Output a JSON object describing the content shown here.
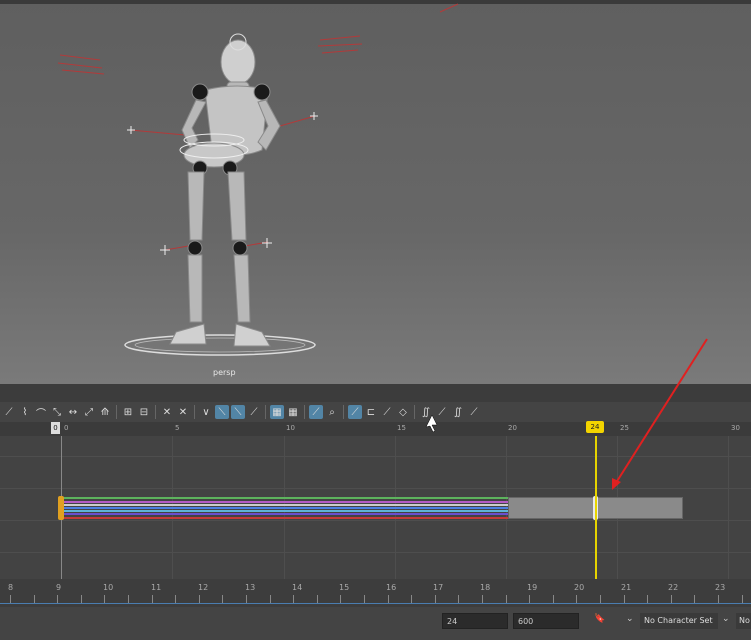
{
  "viewport": {
    "camera_label": "persp"
  },
  "timeline_ruler": {
    "labels": [
      "0",
      "5",
      "10",
      "15",
      "20",
      "25",
      "30"
    ],
    "start_tag": "0"
  },
  "playhead": {
    "frame_label": "24"
  },
  "bottom_ruler": {
    "labels": [
      "8",
      "9",
      "10",
      "11",
      "12",
      "13",
      "14",
      "15",
      "16",
      "17",
      "18",
      "19",
      "20",
      "21",
      "22",
      "23"
    ]
  },
  "range": {
    "current": "24",
    "end": "600"
  },
  "character_set": {
    "label": "No Character Set",
    "label2": "No"
  },
  "toolbar_icons": [
    "move-key-icon",
    "insert-key-icon",
    "lattice-icon",
    "region-icon",
    "retime-icon",
    "frame-all-icon",
    "frame-playback-icon",
    "center-icon",
    "stats-icon",
    "buffer-icon",
    "spline-tangent-icon",
    "linear-tangent-icon",
    "clamped-tangent-icon",
    "stepped-tangent-icon",
    "flat-tangent-icon",
    "break-tangent-icon",
    "unify-tangent-icon",
    "free-weight-icon",
    "lock-weight-icon",
    "auto-load-icon",
    "load-selection-icon",
    "curve-filter-icon",
    "normalize-icon",
    "denormalize-icon",
    "pre-infinity-icon",
    "post-infinity-icon",
    "cycle-icon",
    "oscillate-icon"
  ]
}
